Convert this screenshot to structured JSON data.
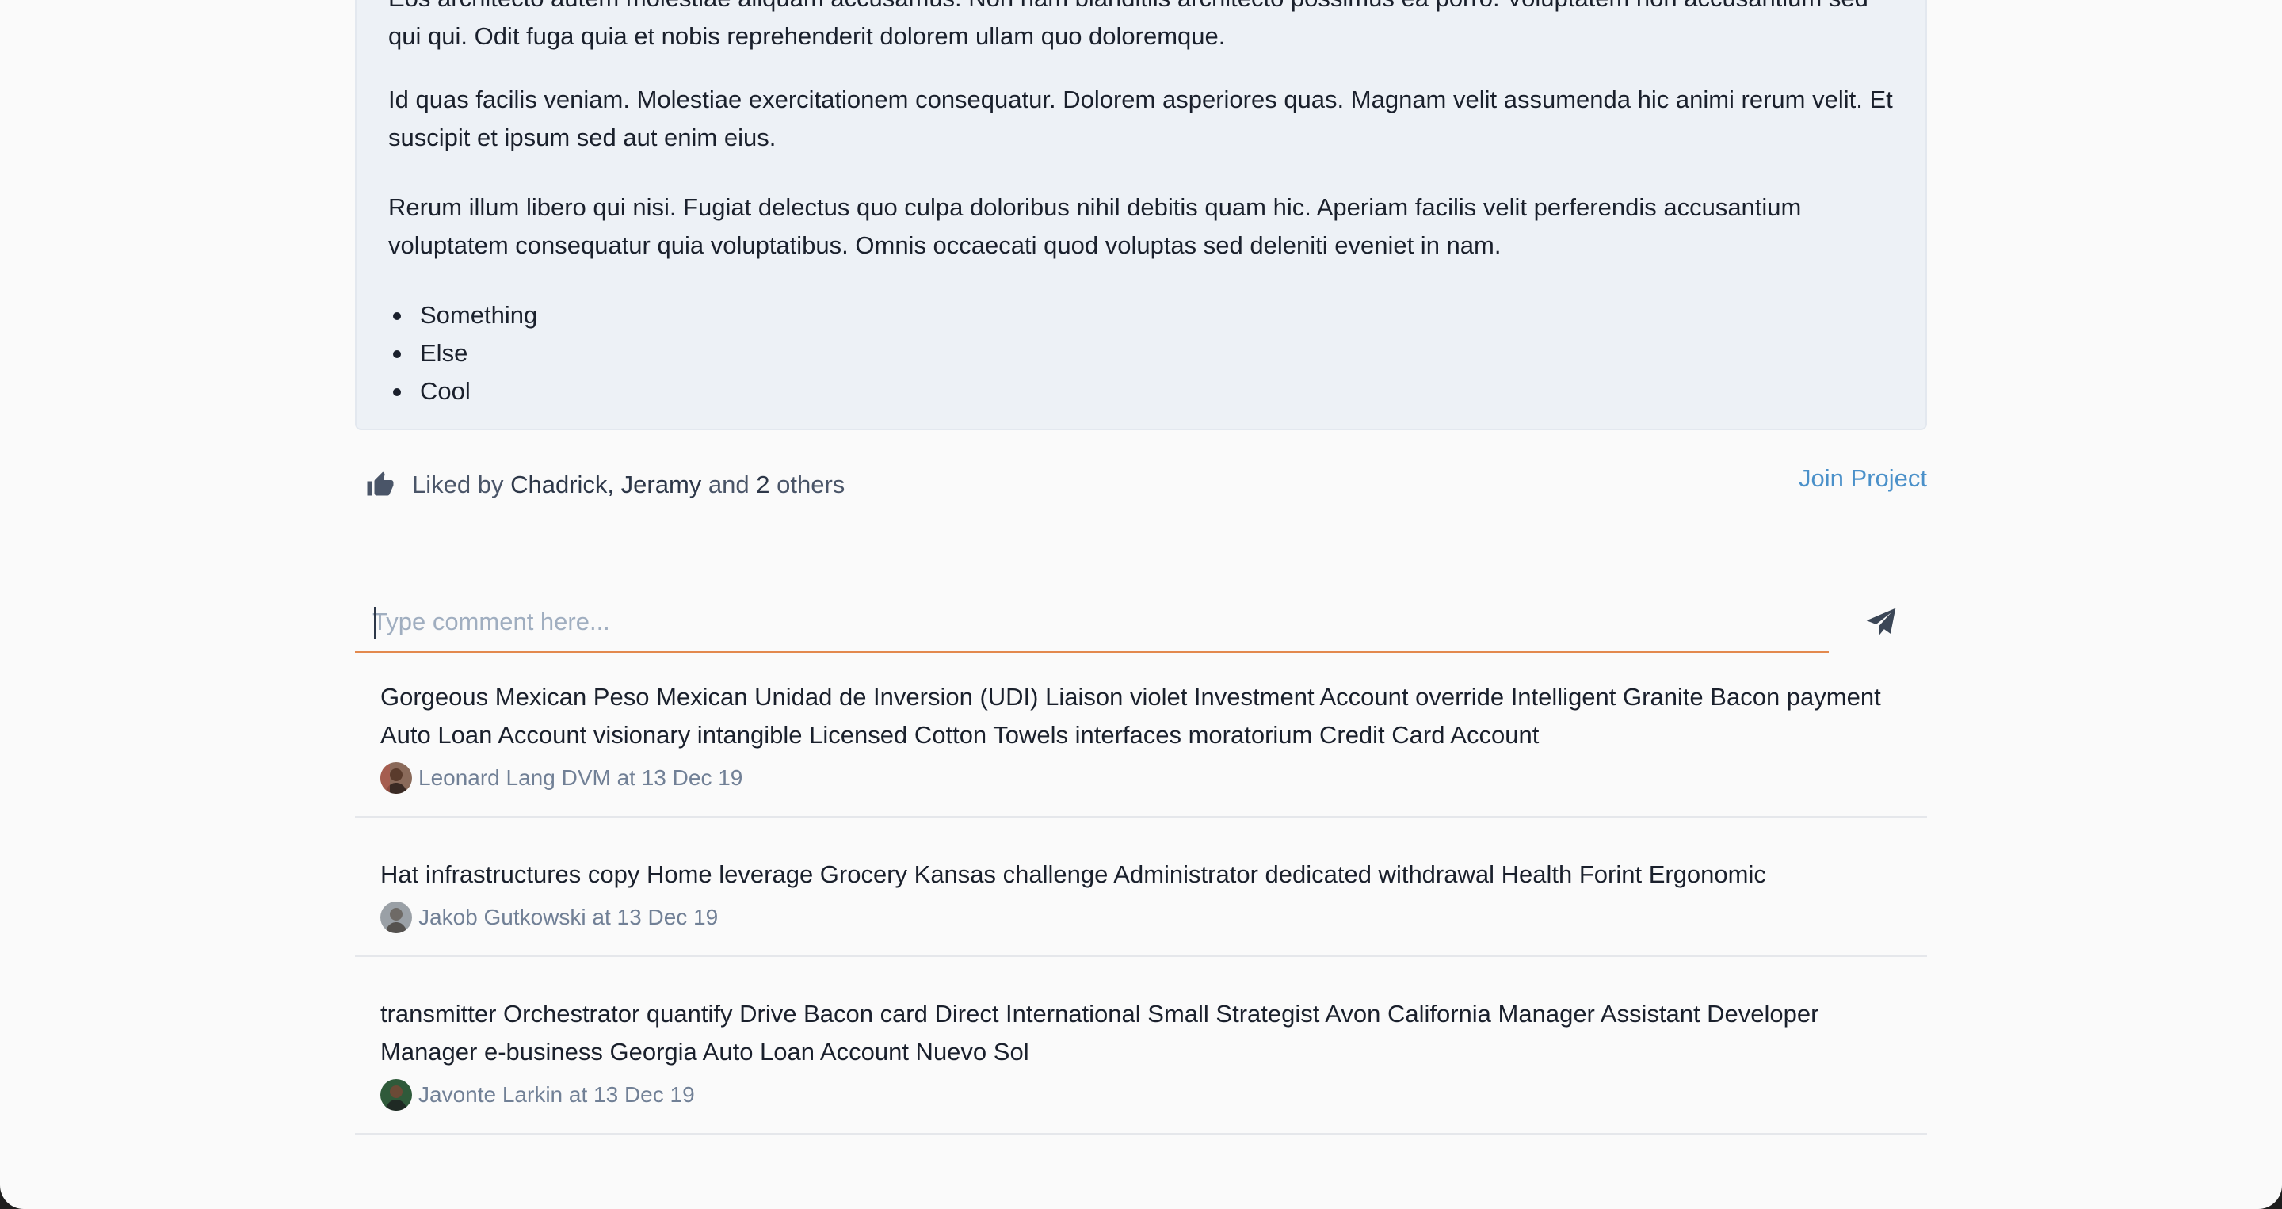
{
  "post": {
    "paragraphs": [
      "Eos architecto autem molestiae aliquam accusamus. Non nam blanditiis architecto possimus ea porro. Voluptatem non accusantium sed qui qui. Odit fuga quia et nobis reprehenderit dolorem ullam quo doloremque.",
      "Id quas facilis veniam. Molestiae exercitationem consequatur. Dolorem asperiores quas. Magnam velit assumenda hic animi rerum velit. Et suscipit et ipsum sed aut enim eius.",
      "Rerum illum libero qui nisi. Fugiat delectus quo culpa doloribus nihil debitis quam hic. Aperiam facilis velit perferendis accusantium voluptatem consequatur quia voluptatibus. Omnis occaecati quod voluptas sed deleniti eveniet in nam."
    ],
    "list_items": [
      "Something",
      "Else",
      "Cool"
    ]
  },
  "likes": {
    "prefix": "Liked by",
    "names": "Chadrick, Jeramy",
    "connector": "and",
    "count": "2",
    "suffix": "others",
    "icon": "thumbs-up-icon"
  },
  "actions": {
    "join_label": "Join Project"
  },
  "comment_form": {
    "placeholder": "Type comment here...",
    "send_icon": "paper-plane-icon"
  },
  "comments": [
    {
      "text": "Gorgeous Mexican Peso Mexican Unidad de Inversion (UDI) Liaison violet Investment Account override Intelligent Granite Bacon payment Auto Loan Account visionary intangible Licensed Cotton Towels interfaces moratorium Credit Card Account",
      "meta": "Leonard Lang DVM at 13 Dec 19"
    },
    {
      "text": "Hat infrastructures copy Home leverage Grocery Kansas challenge Administrator dedicated withdrawal Health Forint Ergonomic",
      "meta": "Jakob Gutkowski at 13 Dec 19"
    },
    {
      "text": "transmitter Orchestrator quantify Drive Bacon card Direct International Small Strategist Avon California Manager Assistant Developer Manager e-business Georgia Auto Loan Account Nuevo Sol",
      "meta": "Javonte Larkin at 13 Dec 19"
    }
  ],
  "colors": {
    "accent_link": "#4a90c9",
    "input_underline": "#e3894e",
    "card_background": "#edf1f6"
  }
}
